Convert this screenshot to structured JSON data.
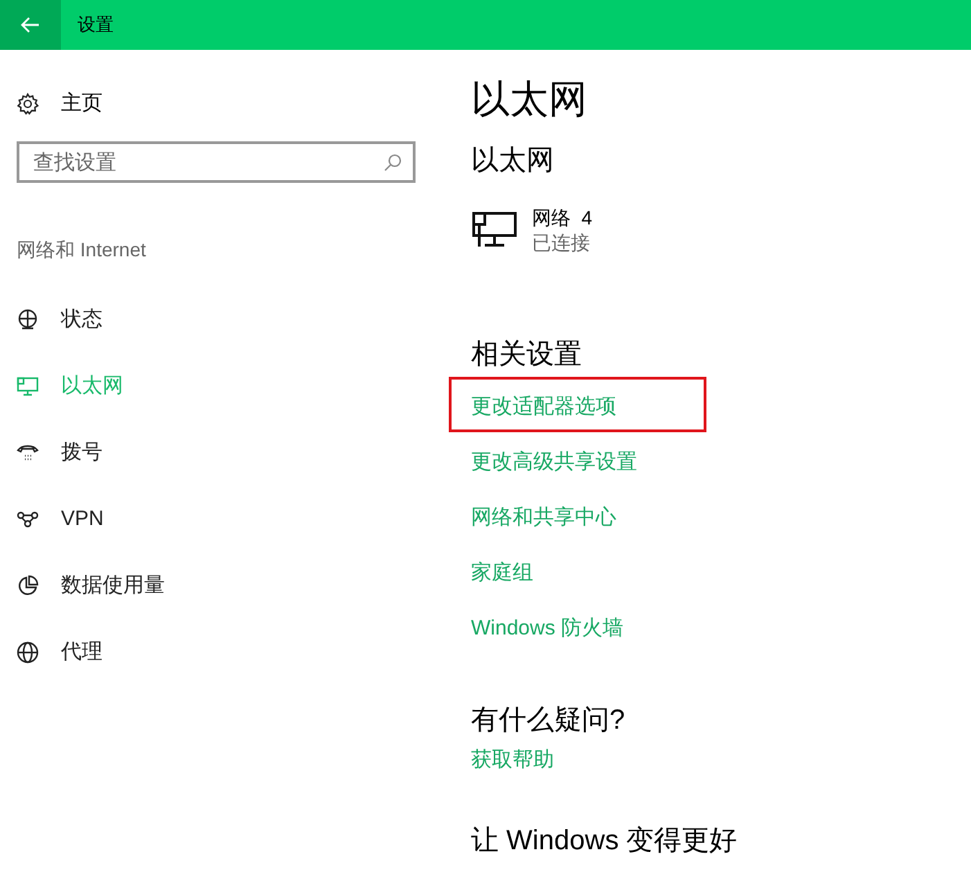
{
  "window": {
    "title": "设置"
  },
  "sidebar": {
    "home": "主页",
    "search": {
      "placeholder": "查找设置"
    },
    "section": "网络和 Internet",
    "items": [
      {
        "label": "状态",
        "selected": false
      },
      {
        "label": "以太网",
        "selected": true
      },
      {
        "label": "拨号",
        "selected": false
      },
      {
        "label": "VPN",
        "selected": false
      },
      {
        "label": "数据使用量",
        "selected": false
      },
      {
        "label": "代理",
        "selected": false
      }
    ]
  },
  "content": {
    "title": "以太网",
    "subtitle": "以太网",
    "network": {
      "name": "网络  4",
      "status": "已连接"
    },
    "related_heading": "相关设置",
    "links": [
      {
        "label": "更改适配器选项",
        "highlighted": true
      },
      {
        "label": "更改高级共享设置",
        "highlighted": false
      },
      {
        "label": "网络和共享中心",
        "highlighted": false
      },
      {
        "label": "家庭组",
        "highlighted": false
      },
      {
        "label": "Windows 防火墙",
        "highlighted": false
      }
    ],
    "question_heading": "有什么疑问?",
    "help_link": "获取帮助",
    "feedback_heading": "让 Windows 变得更好"
  }
}
